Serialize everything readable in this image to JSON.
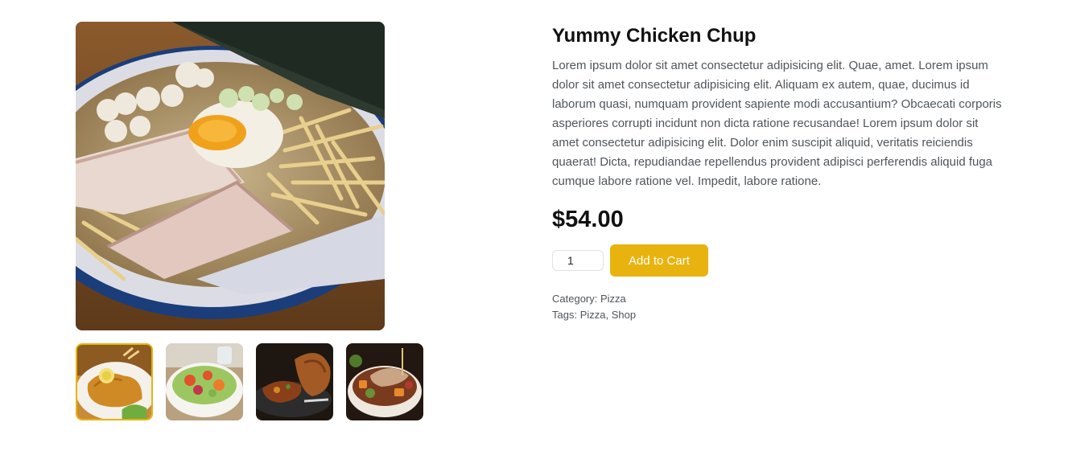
{
  "product": {
    "title": "Yummy Chicken Chup",
    "description": "Lorem ipsum dolor sit amet consectetur adipisicing elit. Quae, amet. Lorem ipsum dolor sit amet consectetur adipisicing elit. Aliquam ex autem, quae, ducimus id laborum quasi, numquam provident sapiente modi accusantium? Obcaecati corporis asperiores corrupti incidunt non dicta ratione recusandae! Lorem ipsum dolor sit amet consectetur adipisicing elit. Dolor enim suscipit aliquid, veritatis reiciendis quaerat! Dicta, repudiandae repellendus provident adipisci perferendis aliquid fuga cumque labore ratione vel. Impedit, labore ratione.",
    "price": "$54.00",
    "quantity": "1",
    "add_to_cart_label": "Add to Cart",
    "category_label": "Category:",
    "category": "Pizza",
    "tags_label": "Tags:",
    "tags": [
      "Pizza",
      "Shop"
    ],
    "tag_separator": ","
  },
  "gallery": {
    "main_image": "ramen-bowl",
    "thumbnails": [
      "fried-chicken-plate",
      "salad-bowl",
      "roast-chicken",
      "chicken-vegetable-bowl"
    ],
    "active_thumbnail": 0
  },
  "colors": {
    "accent": "#e8b30e",
    "text": "#50555a",
    "heading": "#111111"
  }
}
